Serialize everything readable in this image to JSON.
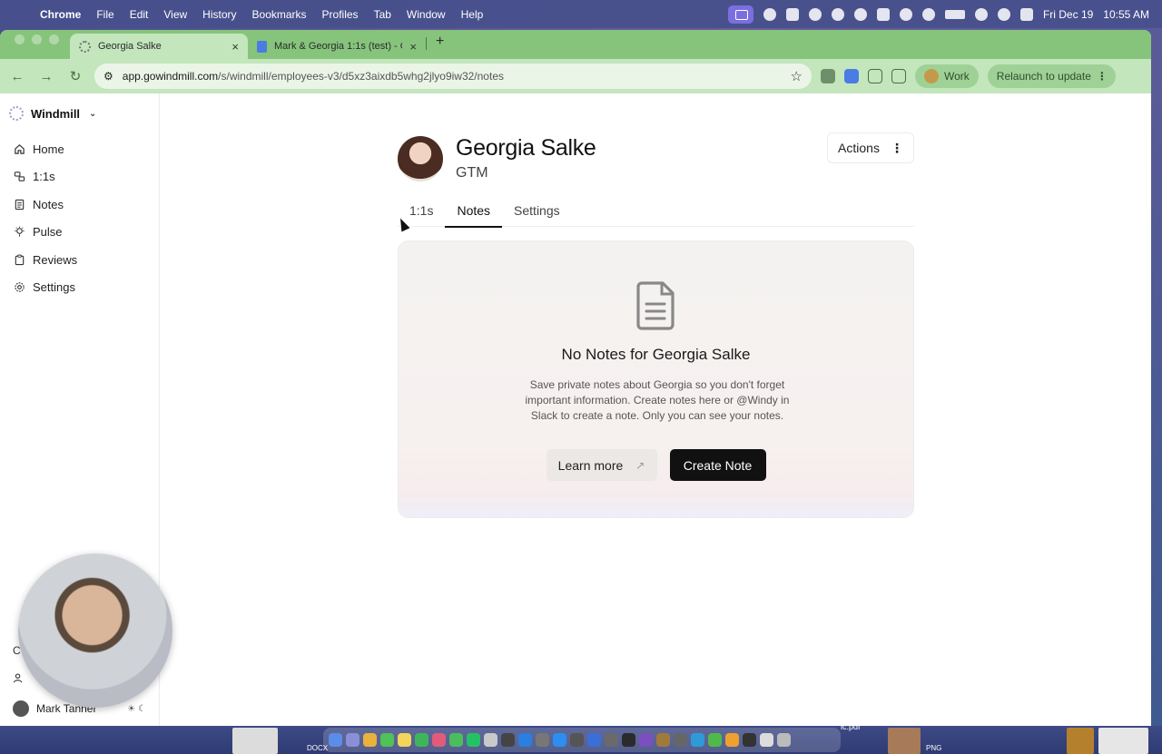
{
  "menubar": {
    "app": "Chrome",
    "items": [
      "File",
      "Edit",
      "View",
      "History",
      "Bookmarks",
      "Profiles",
      "Tab",
      "Window",
      "Help"
    ],
    "date": "Fri Dec 19",
    "time": "10:55 AM"
  },
  "browser": {
    "tabs": [
      {
        "title": "Georgia Salke",
        "close": "×"
      },
      {
        "title": "Mark & Georgia 1:1s (test) - G",
        "close": "×"
      }
    ],
    "new_tab": "+",
    "url_host": "app.gowindmill.com",
    "url_path": "/s/windmill/employees-v3/d5xz3aixdb5whg2jlyo9iw32/notes",
    "profile_chip": "Work",
    "relaunch_label": "Relaunch to update",
    "colors": {
      "tabstrip": "#86c47c",
      "toolbar": "#c3e6bd"
    }
  },
  "sidebar": {
    "workspace": "Windmill",
    "items": [
      {
        "label": "Home",
        "icon": "home-icon"
      },
      {
        "label": "1:1s",
        "icon": "meetings-icon"
      },
      {
        "label": "Notes",
        "icon": "notes-icon"
      },
      {
        "label": "Pulse",
        "icon": "pulse-icon"
      },
      {
        "label": "Reviews",
        "icon": "reviews-icon"
      },
      {
        "label": "Settings",
        "icon": "settings-icon"
      }
    ],
    "bottom_item_partial": "C",
    "user_name": "Mark Tanner"
  },
  "profile": {
    "name": "Georgia Salke",
    "role": "GTM",
    "actions_label": "Actions",
    "tabs": [
      "1:1s",
      "Notes",
      "Settings"
    ],
    "active_tab": "Notes"
  },
  "empty_state": {
    "title": "No Notes for Georgia Salke",
    "description": "Save private notes about Georgia so you don't forget important information. Create notes here or @Windy in Slack to create a note. Only you can see your notes.",
    "learn_more": "Learn more",
    "create_note": "Create Note"
  },
  "dock": {
    "label_docx": "DOCX",
    "label_pdf": "ic.pdf",
    "label_png": "PNG"
  }
}
